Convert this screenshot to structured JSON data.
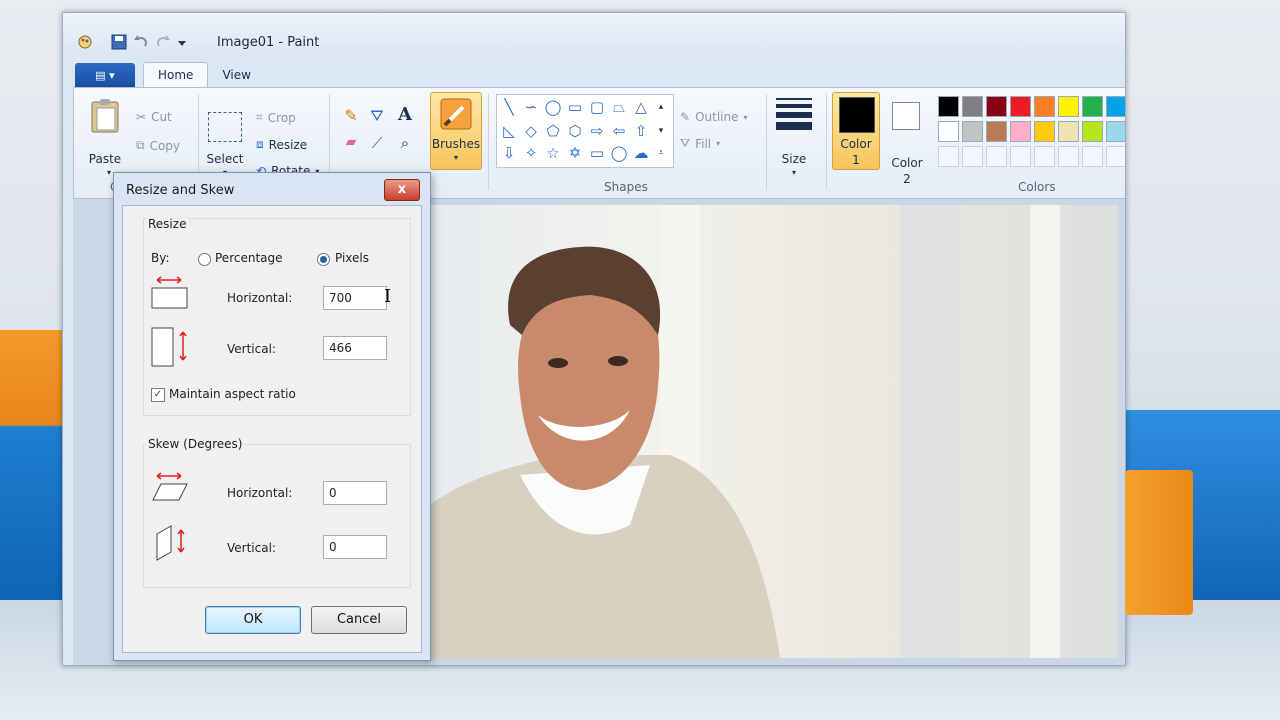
{
  "window": {
    "title": "Image01 - Paint"
  },
  "tabs": {
    "file": "▤ ▾",
    "home": "Home",
    "view": "View"
  },
  "clipboard": {
    "paste": "Paste",
    "cut": "Cut",
    "copy": "Copy",
    "group": "C"
  },
  "image": {
    "select": "Select",
    "crop": "Crop",
    "resize": "Resize",
    "rotate": "Rotate"
  },
  "tools": {
    "brushes": "Brushes"
  },
  "shapes": {
    "group": "Shapes",
    "outline": "Outline",
    "fill": "Fill"
  },
  "size": {
    "label": "Size"
  },
  "colors": {
    "color1_line1": "Color",
    "color1_line2": "1",
    "color2_line1": "Color",
    "color2_line2": "2",
    "group": "Colors",
    "color1": "#000000",
    "color2": "#ffffff",
    "row1": [
      "#000000",
      "#7f7f7f",
      "#880015",
      "#ed1c24",
      "#ff7f27",
      "#fff200",
      "#22b14c",
      "#00a2e8"
    ],
    "row2": [
      "#ffffff",
      "#c3c3c3",
      "#b97a57",
      "#ffaec9",
      "#ffc90e",
      "#efe4b0",
      "#b5e61d",
      "#99d9ea"
    ]
  },
  "dialog": {
    "title": "Resize and Skew",
    "close": "x",
    "resize_section": "Resize",
    "by_label": "By:",
    "percentage": "Percentage",
    "pixels": "Pixels",
    "horizontal_label": "Horizontal:",
    "horizontal_value": "700",
    "vertical_label": "Vertical:",
    "vertical_value": "466",
    "maintain": "Maintain aspect ratio",
    "skew_section": "Skew (Degrees)",
    "skew_h_label": "Horizontal:",
    "skew_h_value": "0",
    "skew_v_label": "Vertical:",
    "skew_v_value": "0",
    "ok": "OK",
    "cancel": "Cancel"
  }
}
